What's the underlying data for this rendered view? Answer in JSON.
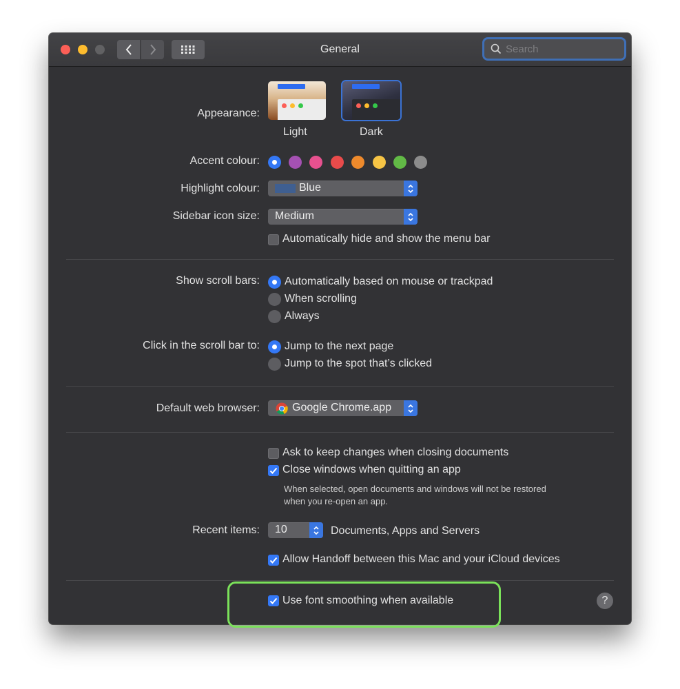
{
  "window": {
    "title": "General"
  },
  "search": {
    "placeholder": "Search"
  },
  "appearance": {
    "label": "Appearance:",
    "options": [
      {
        "label": "Light"
      },
      {
        "label": "Dark",
        "selected": true
      }
    ]
  },
  "accent": {
    "label": "Accent colour:",
    "colors": [
      "#3478f6",
      "#a551b3",
      "#e7518f",
      "#e94b4b",
      "#ee8a2c",
      "#f6c445",
      "#62ba46",
      "#8c8c8c"
    ],
    "selected_index": 0
  },
  "highlight": {
    "label": "Highlight colour:",
    "value": "Blue",
    "swatch_color": "#3f5f91"
  },
  "sidebar_icon_size": {
    "label": "Sidebar icon size:",
    "value": "Medium"
  },
  "auto_hide_menu": {
    "label": "Automatically hide and show the menu bar",
    "checked": false
  },
  "scroll_bars": {
    "label": "Show scroll bars:",
    "options": [
      "Automatically based on mouse or trackpad",
      "When scrolling",
      "Always"
    ],
    "selected_index": 0
  },
  "click_scroll_bar": {
    "label": "Click in the scroll bar to:",
    "options": [
      "Jump to the next page",
      "Jump to the spot that’s clicked"
    ],
    "selected_index": 0
  },
  "default_browser": {
    "label": "Default web browser:",
    "value": "Google Chrome.app"
  },
  "ask_keep_changes": {
    "label": "Ask to keep changes when closing documents",
    "checked": false
  },
  "close_windows": {
    "label": "Close windows when quitting an app",
    "checked": true,
    "note_line1": "When selected, open documents and windows will not be restored",
    "note_line2": "when you re-open an app."
  },
  "recent_items": {
    "label": "Recent items:",
    "value": "10",
    "suffix": "Documents, Apps and Servers"
  },
  "handoff": {
    "label": "Allow Handoff between this Mac and your iCloud devices",
    "checked": true
  },
  "font_smoothing": {
    "label": "Use font smoothing when available",
    "checked": true
  },
  "help": {
    "label": "?"
  },
  "colors": {
    "accent": "#3478f6",
    "annotation": "#7be25a"
  }
}
